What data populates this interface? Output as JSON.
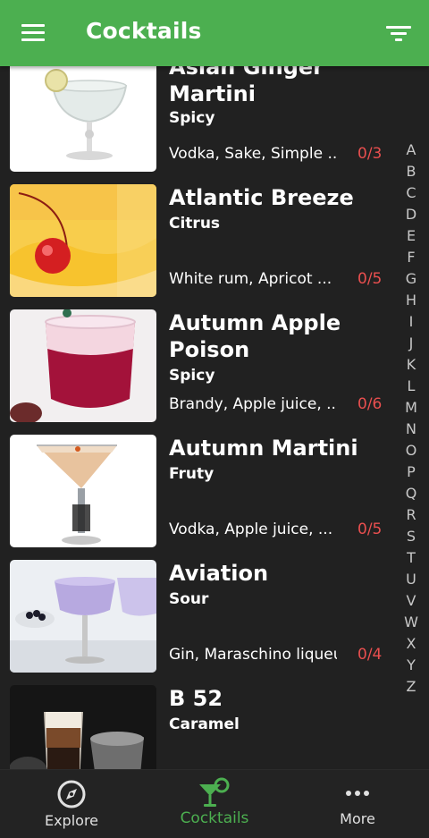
{
  "app_bar": {
    "title": "Cocktails",
    "color": "#4caf50"
  },
  "cocktails": [
    {
      "name": "Asian Ginger Martini",
      "taste": "Spicy",
      "ingredients": "Vodka, Sake, Simple ...",
      "count": "0/3"
    },
    {
      "name": "Atlantic Breeze",
      "taste": "Citrus",
      "ingredients": "White rum, Apricot ...",
      "count": "0/5"
    },
    {
      "name": "Autumn Apple Poison",
      "taste": "Spicy",
      "ingredients": "Brandy, Apple juice, ...",
      "count": "0/6"
    },
    {
      "name": "Autumn Martini",
      "taste": "Fruty",
      "ingredients": "Vodka, Apple juice, ...",
      "count": "0/5"
    },
    {
      "name": "Aviation",
      "taste": "Sour",
      "ingredients": "Gin, Maraschino liqueu...",
      "count": "0/4"
    },
    {
      "name": "B 52",
      "taste": "Caramel",
      "ingredients": "",
      "count": ""
    }
  ],
  "alphabet": [
    "A",
    "B",
    "C",
    "D",
    "E",
    "F",
    "G",
    "H",
    "I",
    "J",
    "K",
    "L",
    "M",
    "N",
    "O",
    "P",
    "Q",
    "R",
    "S",
    "T",
    "U",
    "V",
    "W",
    "X",
    "Y",
    "Z"
  ],
  "bottom_nav": [
    {
      "label": "Explore",
      "icon": "compass-icon",
      "active": false
    },
    {
      "label": "Cocktails",
      "icon": "cocktail-glass-icon",
      "active": true
    },
    {
      "label": "More",
      "icon": "more-dots-icon",
      "active": false
    }
  ],
  "colors": {
    "background": "#212121",
    "count_red": "#e94f4f",
    "active_green": "#4caf50"
  }
}
